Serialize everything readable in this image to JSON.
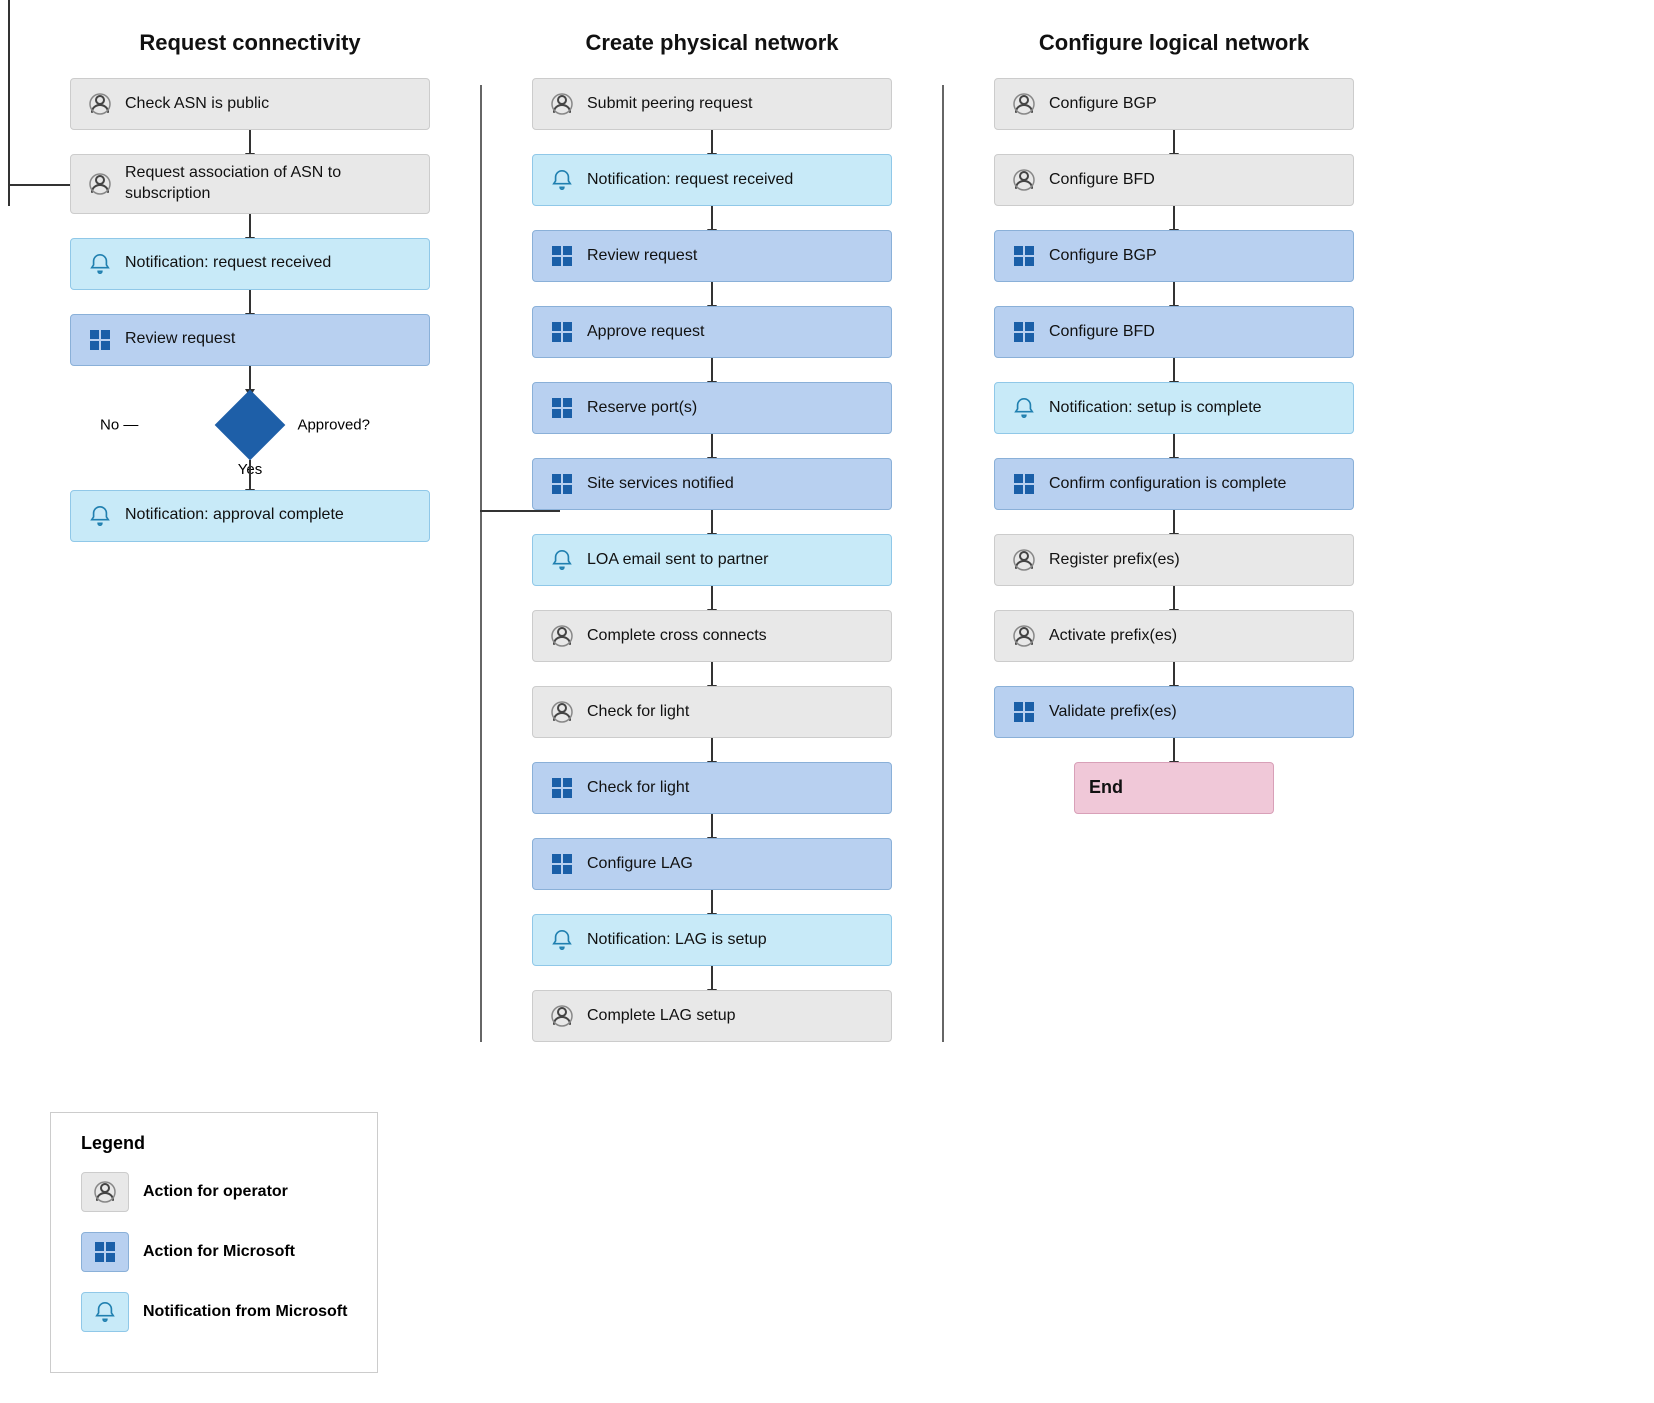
{
  "columns": [
    {
      "title": "Request connectivity",
      "nodes": [
        {
          "type": "operator",
          "text": "Check ASN is public"
        },
        {
          "type": "operator",
          "text": "Request association of ASN to subscription"
        },
        {
          "type": "notification",
          "text": "Notification: request received"
        },
        {
          "type": "microsoft",
          "text": "Review request"
        },
        {
          "type": "decision",
          "text": "Approved?",
          "no_label": "No",
          "yes_label": "Yes"
        },
        {
          "type": "notification",
          "text": "Notification: approval complete"
        }
      ]
    },
    {
      "title": "Create physical network",
      "nodes": [
        {
          "type": "operator",
          "text": "Submit peering request"
        },
        {
          "type": "notification",
          "text": "Notification: request received"
        },
        {
          "type": "microsoft",
          "text": "Review request"
        },
        {
          "type": "microsoft",
          "text": "Approve request"
        },
        {
          "type": "microsoft",
          "text": "Reserve port(s)"
        },
        {
          "type": "microsoft",
          "text": "Site services notified"
        },
        {
          "type": "notification",
          "text": "LOA email sent to partner"
        },
        {
          "type": "operator",
          "text": "Complete cross connects"
        },
        {
          "type": "operator",
          "text": "Check for light"
        },
        {
          "type": "microsoft",
          "text": "Check for light"
        },
        {
          "type": "microsoft",
          "text": "Configure LAG"
        },
        {
          "type": "notification",
          "text": "Notification: LAG is setup"
        },
        {
          "type": "operator",
          "text": "Complete LAG setup"
        }
      ]
    },
    {
      "title": "Configure logical network",
      "nodes": [
        {
          "type": "operator",
          "text": "Configure BGP"
        },
        {
          "type": "operator",
          "text": "Configure BFD"
        },
        {
          "type": "microsoft",
          "text": "Configure BGP"
        },
        {
          "type": "microsoft",
          "text": "Configure BFD"
        },
        {
          "type": "notification",
          "text": "Notification: setup is complete"
        },
        {
          "type": "microsoft",
          "text": "Confirm configuration is complete"
        },
        {
          "type": "operator",
          "text": "Register prefix(es)"
        },
        {
          "type": "operator",
          "text": "Activate prefix(es)"
        },
        {
          "type": "microsoft",
          "text": "Validate prefix(es)"
        },
        {
          "type": "end",
          "text": "End"
        }
      ]
    }
  ],
  "legend": {
    "title": "Legend",
    "items": [
      {
        "type": "operator",
        "label": "Action for operator"
      },
      {
        "type": "microsoft",
        "label": "Action for Microsoft"
      },
      {
        "type": "notification",
        "label": "Notification from Microsoft"
      }
    ]
  }
}
